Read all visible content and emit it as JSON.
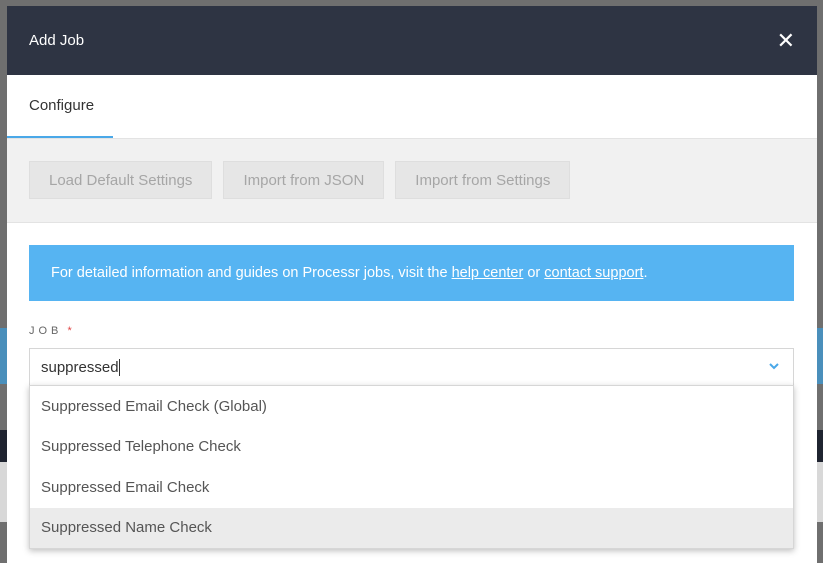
{
  "modal": {
    "title": "Add Job",
    "close_icon": "close-icon",
    "tabs": [
      {
        "label": "Configure",
        "active": true
      }
    ],
    "toolbar": {
      "buttons": [
        "Load Default Settings",
        "Import from JSON",
        "Import from Settings"
      ]
    },
    "info": {
      "text_before": "For detailed information and guides on Processr jobs, visit the ",
      "help_link": "help center",
      "text_middle": " or ",
      "support_link": "contact support",
      "text_after": "."
    },
    "job_field": {
      "label": "JOB",
      "required_mark": "*",
      "value": "suppressed",
      "options": [
        "Suppressed Email Check (Global)",
        "Suppressed Telephone Check",
        "Suppressed Email Check",
        "Suppressed Name Check"
      ],
      "highlighted_option": "Suppressed Name Check"
    }
  },
  "colors": {
    "header_bg": "#2e3443",
    "info_bg": "#56b4f2",
    "tab_underline": "#4aa8e8",
    "required": "#e04545"
  }
}
